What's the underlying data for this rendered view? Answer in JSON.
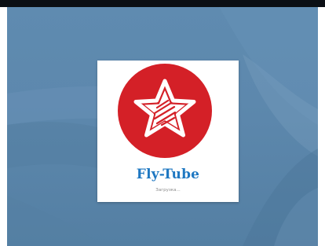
{
  "app": {
    "name": "Fly-Tube",
    "loading_text": "Загрузка..."
  },
  "logo": {
    "icon": "star-icon",
    "circle_color": "#d42027",
    "name_color": "#1f78c2"
  },
  "background": {
    "color": "#5f8bb0"
  }
}
